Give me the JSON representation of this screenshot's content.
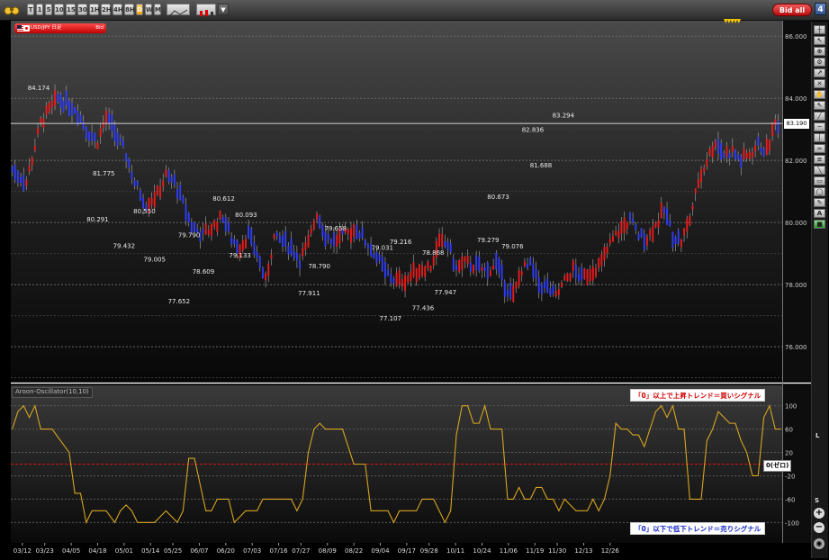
{
  "toolbar": {
    "timeframes": [
      "T",
      "1",
      "5",
      "10",
      "15",
      "30",
      "1H",
      "2H",
      "4H",
      "8H",
      "D",
      "W",
      "M"
    ],
    "active_timeframe": "D",
    "bid_all_label": "Bid all",
    "panel_number": "4"
  },
  "instrument": {
    "symbol_label": "USD/JPY 日足",
    "side_label": "Bid",
    "current_price": "83.190"
  },
  "indicator": {
    "name": "Aroon-Oscillator(10,10)",
    "zero_label": "0(ゼロ)",
    "buy_note": "「0」以上で上昇トレンド＝買いシグナル",
    "sell_note": "「0」以下で低下トレンド＝売りシグナル"
  },
  "right_tools": {
    "s_label": "S",
    "l_label": "L"
  },
  "colors": {
    "up_candle": "#e31b1b",
    "down_candle": "#2e3cf0",
    "oscillator_line": "#d7a520",
    "zero_line": "#e01010",
    "current_price_line": "#d8d8d8"
  },
  "chart_data": [
    {
      "type": "candlestick",
      "price_axis_ticks": [
        "86.000",
        "84.000",
        "82.000",
        "80.000",
        "78.000",
        "76.000"
      ],
      "ylim": [
        74.9,
        86.5
      ],
      "x_ticks": [
        "03/12",
        "03/23",
        "04/05",
        "04/18",
        "05/01",
        "05/14",
        "05/25",
        "06/07",
        "06/20",
        "07/03",
        "07/16",
        "07/27",
        "08/09",
        "08/22",
        "09/04",
        "09/17",
        "09/28",
        "10/11",
        "10/24",
        "11/06",
        "11/19",
        "11/30",
        "12/13",
        "12/26"
      ],
      "annotations": [
        {
          "label": "84.174",
          "x": "03/20",
          "y": 84.174
        },
        {
          "label": "81.775",
          "x": "04/21",
          "y": 81.775
        },
        {
          "label": "80.291",
          "x": "04/18",
          "y": 80.291
        },
        {
          "label": "80.550",
          "x": "05/11",
          "y": 80.55
        },
        {
          "label": "79.432",
          "x": "05/01",
          "y": 79.432
        },
        {
          "label": "79.005",
          "x": "05/16",
          "y": 79.005
        },
        {
          "label": "79.790",
          "x": "06/02",
          "y": 79.79
        },
        {
          "label": "77.652",
          "x": "05/28",
          "y": 77.652
        },
        {
          "label": "78.609",
          "x": "06/09",
          "y": 78.609
        },
        {
          "label": "80.612",
          "x": "06/19",
          "y": 80.612
        },
        {
          "label": "80.093",
          "x": "06/30",
          "y": 80.093
        },
        {
          "label": "79.133",
          "x": "06/27",
          "y": 79.133
        },
        {
          "label": "77.911",
          "x": "07/31",
          "y": 77.911
        },
        {
          "label": "78.790",
          "x": "08/05",
          "y": 78.79
        },
        {
          "label": "79.658",
          "x": "08/13",
          "y": 79.658
        },
        {
          "label": "79.031",
          "x": "09/05",
          "y": 79.031
        },
        {
          "label": "79.216",
          "x": "09/14",
          "y": 79.216
        },
        {
          "label": "77.107",
          "x": "09/09",
          "y": 77.107
        },
        {
          "label": "78.868",
          "x": "09/30",
          "y": 78.868
        },
        {
          "label": "77.436",
          "x": "09/25",
          "y": 77.436
        },
        {
          "label": "77.947",
          "x": "10/06",
          "y": 77.947
        },
        {
          "label": "80.673",
          "x": "11/01",
          "y": 80.673
        },
        {
          "label": "79.279",
          "x": "10/27",
          "y": 79.279
        },
        {
          "label": "79.076",
          "x": "11/08",
          "y": 79.076
        },
        {
          "label": "82.836",
          "x": "11/18",
          "y": 82.836
        },
        {
          "label": "81.688",
          "x": "11/22",
          "y": 81.688
        },
        {
          "label": "83.294",
          "x": "12/03",
          "y": 83.294
        }
      ],
      "trend_path": [
        [
          0,
          81.7
        ],
        [
          5,
          81.3
        ],
        [
          10,
          83.2
        ],
        [
          16,
          84.0
        ],
        [
          22,
          83.7
        ],
        [
          26,
          83.0
        ],
        [
          30,
          82.6
        ],
        [
          33,
          83.4
        ],
        [
          36,
          82.9
        ],
        [
          40,
          82.2
        ],
        [
          43,
          81.3
        ],
        [
          47,
          80.6
        ],
        [
          51,
          80.9
        ],
        [
          54,
          81.5
        ],
        [
          57,
          81.3
        ],
        [
          60,
          80.6
        ],
        [
          63,
          79.9
        ],
        [
          67,
          79.6
        ],
        [
          71,
          79.9
        ],
        [
          74,
          80.2
        ],
        [
          77,
          79.5
        ],
        [
          80,
          79.2
        ],
        [
          83,
          79.6
        ],
        [
          86,
          79.0
        ],
        [
          89,
          78.1
        ],
        [
          92,
          79.5
        ],
        [
          95,
          79.4
        ],
        [
          98,
          79.2
        ],
        [
          101,
          78.8
        ],
        [
          104,
          79.3
        ],
        [
          107,
          80.3
        ],
        [
          110,
          79.6
        ],
        [
          113,
          79.4
        ],
        [
          117,
          79.6
        ],
        [
          121,
          79.8
        ],
        [
          125,
          79.3
        ],
        [
          128,
          78.9
        ],
        [
          131,
          78.4
        ],
        [
          135,
          78.1
        ],
        [
          139,
          78.2
        ],
        [
          143,
          78.5
        ],
        [
          147,
          78.6
        ],
        [
          150,
          79.3
        ],
        [
          153,
          79.3
        ],
        [
          156,
          78.5
        ],
        [
          159,
          78.7
        ],
        [
          163,
          78.6
        ],
        [
          167,
          78.4
        ],
        [
          170,
          78.7
        ],
        [
          173,
          78.0
        ],
        [
          176,
          77.6
        ],
        [
          179,
          78.5
        ],
        [
          182,
          78.6
        ],
        [
          185,
          78.0
        ],
        [
          188,
          77.9
        ],
        [
          191,
          77.6
        ],
        [
          194,
          78.1
        ],
        [
          197,
          78.5
        ],
        [
          200,
          78.2
        ],
        [
          203,
          78.4
        ],
        [
          207,
          78.7
        ],
        [
          210,
          79.3
        ],
        [
          213,
          79.7
        ],
        [
          217,
          80.1
        ],
        [
          220,
          79.6
        ],
        [
          223,
          79.5
        ],
        [
          226,
          79.9
        ],
        [
          229,
          80.4
        ],
        [
          232,
          79.6
        ],
        [
          235,
          79.4
        ],
        [
          238,
          80.1
        ],
        [
          241,
          81.3
        ],
        [
          244,
          82.0
        ],
        [
          247,
          82.6
        ],
        [
          250,
          82.2
        ],
        [
          253,
          82.3
        ],
        [
          256,
          82.0
        ],
        [
          259,
          82.2
        ],
        [
          262,
          82.5
        ],
        [
          265,
          82.3
        ],
        [
          268,
          83.2
        ]
      ]
    },
    {
      "type": "line",
      "name": "Aroon-Oscillator(10,10)",
      "y_ticks": [
        "100",
        "60",
        "20",
        "-20",
        "-60",
        "-100"
      ],
      "ylim": [
        -135,
        135
      ],
      "x": [
        0,
        2,
        4,
        6,
        8,
        10,
        12,
        14,
        17,
        20,
        22,
        24,
        26,
        28,
        30,
        33,
        36,
        38,
        40,
        42,
        44,
        46,
        50,
        54,
        58,
        60,
        62,
        64,
        68,
        70,
        72,
        74,
        76,
        78,
        80,
        82,
        84,
        86,
        88,
        90,
        92,
        94,
        96,
        98,
        100,
        102,
        104,
        106,
        108,
        110,
        112,
        114,
        116,
        118,
        120,
        124,
        126,
        128,
        130,
        132,
        134,
        136,
        138,
        140,
        142,
        144,
        146,
        148,
        150,
        152,
        154,
        156,
        158,
        160,
        162,
        164,
        166,
        168,
        170,
        172,
        174,
        176,
        178,
        180,
        182,
        184,
        186,
        188,
        190,
        192,
        194,
        196,
        198,
        200,
        202,
        204,
        206,
        208,
        210,
        212,
        214,
        216,
        218,
        220,
        222,
        224,
        226,
        228,
        230,
        232,
        234,
        236,
        238,
        240,
        242,
        244,
        246,
        248,
        250,
        252,
        254,
        256,
        258,
        260,
        262,
        264,
        266,
        268,
        270
      ],
      "values": [
        60,
        90,
        100,
        80,
        100,
        60,
        60,
        60,
        40,
        20,
        -50,
        -50,
        -100,
        -80,
        -80,
        -80,
        -100,
        -80,
        -70,
        -80,
        -100,
        -100,
        -100,
        -80,
        -100,
        -80,
        10,
        10,
        -80,
        -80,
        -60,
        -60,
        -60,
        -100,
        -90,
        -80,
        -80,
        -80,
        -60,
        -60,
        -60,
        -60,
        -60,
        -60,
        -80,
        -60,
        20,
        60,
        70,
        60,
        60,
        60,
        60,
        30,
        0,
        0,
        -80,
        -80,
        -80,
        -80,
        -100,
        -80,
        -80,
        -80,
        -80,
        -60,
        -60,
        -60,
        -80,
        -100,
        -80,
        50,
        100,
        100,
        70,
        70,
        100,
        60,
        60,
        60,
        -60,
        -60,
        -40,
        -60,
        -60,
        -40,
        -40,
        -60,
        -60,
        -80,
        -60,
        -70,
        -80,
        -80,
        -80,
        -60,
        -80,
        -60,
        -20,
        70,
        60,
        60,
        50,
        50,
        30,
        60,
        90,
        100,
        80,
        100,
        60,
        60,
        -60,
        -60,
        -60,
        40,
        60,
        90,
        80,
        70,
        70,
        40,
        20,
        -20,
        -20,
        80,
        100,
        60,
        60,
        60
      ]
    }
  ]
}
